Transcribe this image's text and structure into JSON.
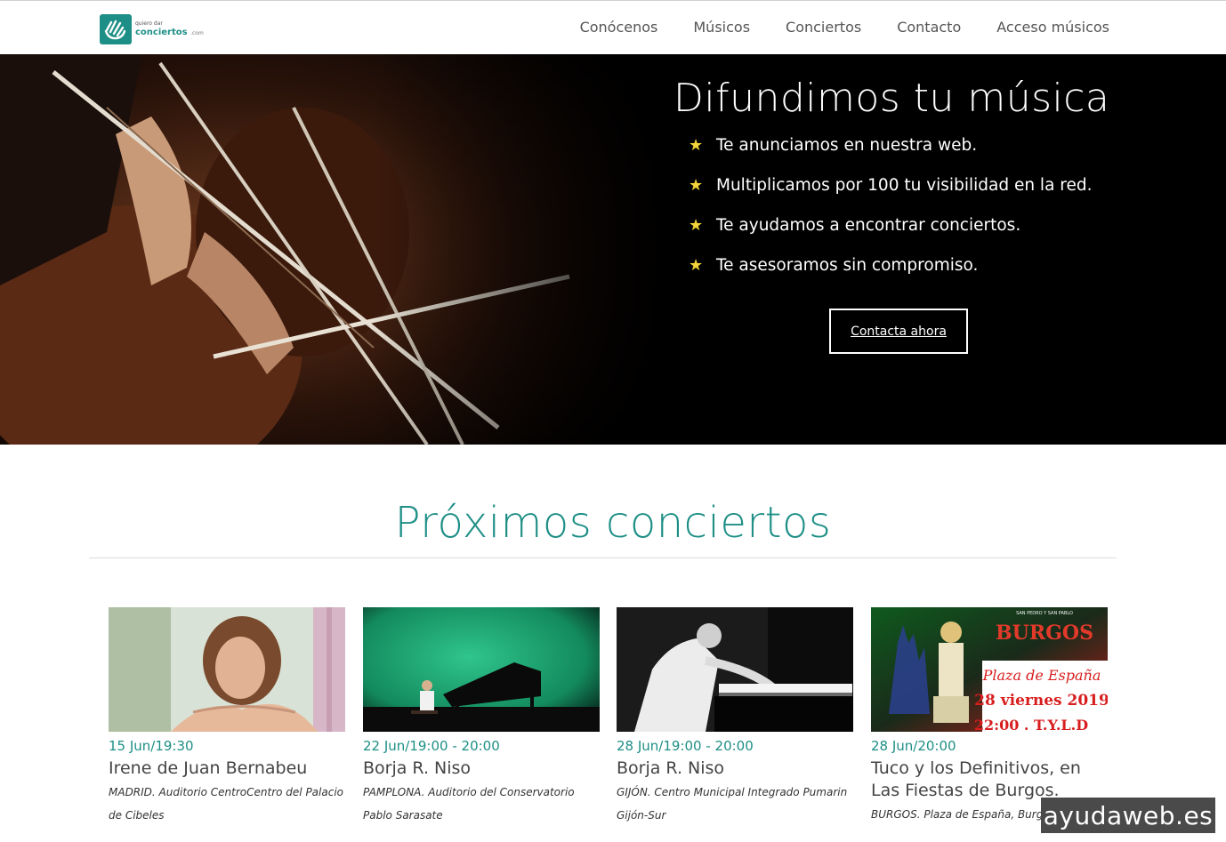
{
  "header": {
    "logo": {
      "small": "quiero dar",
      "big": "conciertos",
      "suffix": ".com"
    },
    "nav": [
      "Conócenos",
      "Músicos",
      "Conciertos",
      "Contacto",
      "Acceso músicos"
    ]
  },
  "hero": {
    "title": "Difundimos tu música",
    "bullets": [
      "Te anunciamos en nuestra web.",
      "Multiplicamos por 100 tu visibilidad en la red.",
      "Te ayudamos a encontrar conciertos.",
      "Te asesoramos sin compromiso."
    ],
    "bullet_icon": "★",
    "cta_label": "Contacta ahora"
  },
  "concerts": {
    "title": "Próximos conciertos",
    "items": [
      {
        "date": "15 Jun/19:30",
        "title": "Irene de Juan Bernabeu",
        "venue": "MADRID. Auditorio CentroCentro del Palacio de Cibeles",
        "image": "portrait-photo"
      },
      {
        "date": "22 Jun/19:00 - 20:00",
        "title": "Borja R. Niso",
        "venue": "PAMPLONA. Auditorio del Conservatorio Pablo Sarasate",
        "image": "piano-stage-photo"
      },
      {
        "date": "28 Jun/19:00 - 20:00",
        "title": "Borja R. Niso",
        "venue": "GIJÓN. Centro Municipal Integrado Pumarin Gijón-Sur",
        "image": "pianist-bw-photo"
      },
      {
        "date": "28 Jun/20:00",
        "title": "Tuco y los Definitivos, en Las Fiestas de Burgos.",
        "venue": "BURGOS. Plaza de España, Burgos",
        "image": "burgos-poster",
        "poster": {
          "top": "SAN PEDRO Y SAN PABLO",
          "city": "BURGOS",
          "place": "Plaza de España",
          "date": "28 viernes 2019",
          "time": "22:00 . T.Y.L.D"
        }
      }
    ]
  },
  "watermark": "ayudaweb.es",
  "colors": {
    "accent": "#1e8f86",
    "star": "#f2d43a",
    "hero_bg": "#000000"
  }
}
